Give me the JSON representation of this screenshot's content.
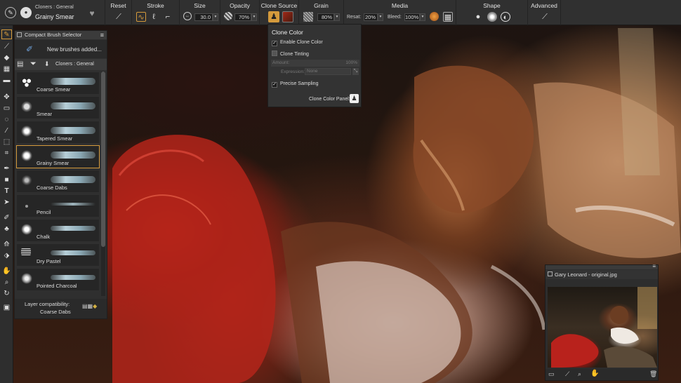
{
  "brush_header": {
    "category": "Cloners : General",
    "variant": "Grainy Smear"
  },
  "toolbar": {
    "sections": {
      "reset": "Reset",
      "stroke": "Stroke",
      "size": "Size",
      "opacity": "Opacity",
      "clone_source": "Clone Source",
      "grain": "Grain",
      "media": "Media",
      "shape": "Shape",
      "advanced": "Advanced"
    },
    "size_value": "30.0",
    "opacity_value": "70%",
    "grain_value": "80%",
    "resat_label": "Resat:",
    "resat_value": "20%",
    "bleed_label": "Bleed:",
    "bleed_value": "100%"
  },
  "brush_selector": {
    "title": "Compact Brush Selector",
    "notice": "New brushes added...",
    "category": "Cloners : General",
    "brushes": [
      {
        "name": "Coarse Smear"
      },
      {
        "name": "Smear"
      },
      {
        "name": "Tapered Smear"
      },
      {
        "name": "Grainy Smear"
      },
      {
        "name": "Coarse Dabs"
      },
      {
        "name": "Pencil"
      },
      {
        "name": "Chalk"
      },
      {
        "name": "Dry Pastel"
      },
      {
        "name": "Pointed Charcoal"
      }
    ],
    "layer_compat_label": "Layer compatibility:",
    "layer_compat_value": "Coarse Dabs"
  },
  "clone_color": {
    "title": "Clone Color",
    "enable_label": "Enable Clone Color",
    "enable_checked": true,
    "tinting_label": "Clone Tinting",
    "tinting_checked": false,
    "amount_label": "Amount:",
    "amount_value": "100%",
    "expression_label": "Expression:",
    "expression_value": "None",
    "precise_label": "Precise Sampling",
    "precise_checked": true,
    "panel_label": "Clone Color Panel:"
  },
  "reference_panel": {
    "title": "Gary Leonard - original.jpg"
  },
  "colors": {
    "accent": "#d49a3c",
    "panel_bg": "#2f2f2f",
    "toolbar_bg": "#303030"
  }
}
